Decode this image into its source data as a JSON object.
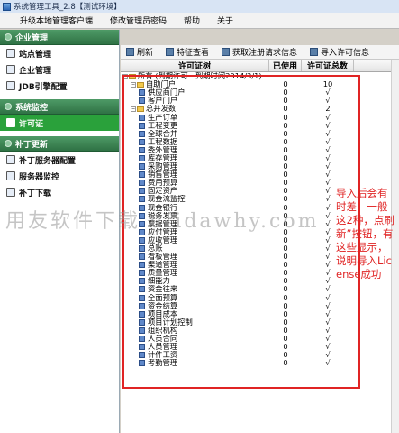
{
  "window": {
    "title": "系统管理工具_2.8【测试环境】"
  },
  "menubar": {
    "items": [
      "升级本地管理客户端",
      "修改管理员密码",
      "帮助",
      "关于"
    ]
  },
  "sidebar": {
    "sections": [
      {
        "header": "企业管理",
        "items": [
          "站点管理",
          "企业管理",
          "JDB引擎配置"
        ]
      },
      {
        "header": "系统监控",
        "items": [
          "许可证"
        ]
      },
      {
        "header": "补丁更新",
        "items": [
          "补丁服务器配置",
          "服务器监控",
          "补丁下载"
        ]
      }
    ],
    "active": "许可证"
  },
  "toolbar": {
    "buttons": [
      "刷新",
      "特征查看",
      "获取注册请求信息",
      "导入许可信息"
    ]
  },
  "grid": {
    "columns": [
      "许可证树",
      "已使用",
      "许可证总数"
    ],
    "rows": [
      {
        "level": 0,
        "type": "folder",
        "name": "所有 (到期许可一到期时间2014/3/1)",
        "used": "",
        "total": ""
      },
      {
        "level": 1,
        "type": "folder",
        "name": "自助门户",
        "used": "0",
        "total": "10"
      },
      {
        "level": 2,
        "type": "leaf",
        "name": "供应商门户",
        "used": "0",
        "total": "√"
      },
      {
        "level": 2,
        "type": "leaf",
        "name": "客户门户",
        "used": "0",
        "total": "√"
      },
      {
        "level": 1,
        "type": "folder",
        "name": "总并发数",
        "used": "0",
        "total": "2"
      },
      {
        "level": 2,
        "type": "leaf",
        "name": "生产订单",
        "used": "0",
        "total": "√"
      },
      {
        "level": 2,
        "type": "leaf",
        "name": "工程变更",
        "used": "0",
        "total": "√"
      },
      {
        "level": 2,
        "type": "leaf",
        "name": "全球合并",
        "used": "0",
        "total": "√"
      },
      {
        "level": 2,
        "type": "leaf",
        "name": "工程数据",
        "used": "0",
        "total": "√"
      },
      {
        "level": 2,
        "type": "leaf",
        "name": "委外管理",
        "used": "0",
        "total": "√"
      },
      {
        "level": 2,
        "type": "leaf",
        "name": "库存管理",
        "used": "0",
        "total": "√"
      },
      {
        "level": 2,
        "type": "leaf",
        "name": "采购管理",
        "used": "0",
        "total": "√"
      },
      {
        "level": 2,
        "type": "leaf",
        "name": "销售管理",
        "used": "0",
        "total": "√"
      },
      {
        "level": 2,
        "type": "leaf",
        "name": "费用预算",
        "used": "0",
        "total": "√"
      },
      {
        "level": 2,
        "type": "leaf",
        "name": "固定资产",
        "used": "0",
        "total": "√"
      },
      {
        "level": 2,
        "type": "leaf",
        "name": "现金流监控",
        "used": "0",
        "total": "√"
      },
      {
        "level": 2,
        "type": "leaf",
        "name": "现金银行",
        "used": "0",
        "total": "√"
      },
      {
        "level": 2,
        "type": "leaf",
        "name": "税务发票",
        "used": "0",
        "total": "√"
      },
      {
        "level": 2,
        "type": "leaf",
        "name": "票据管理",
        "used": "0",
        "total": "√"
      },
      {
        "level": 2,
        "type": "leaf",
        "name": "应付管理",
        "used": "0",
        "total": "√"
      },
      {
        "level": 2,
        "type": "leaf",
        "name": "应收管理",
        "used": "0",
        "total": "√"
      },
      {
        "level": 2,
        "type": "leaf",
        "name": "总账",
        "used": "0",
        "total": "√"
      },
      {
        "level": 2,
        "type": "leaf",
        "name": "看板管理",
        "used": "0",
        "total": "√"
      },
      {
        "level": 2,
        "type": "leaf",
        "name": "渠道管理",
        "used": "0",
        "total": "√"
      },
      {
        "level": 2,
        "type": "leaf",
        "name": "质量管理",
        "used": "0",
        "total": "√"
      },
      {
        "level": 2,
        "type": "leaf",
        "name": "细能力",
        "used": "0",
        "total": "√"
      },
      {
        "level": 2,
        "type": "leaf",
        "name": "资金往来",
        "used": "0",
        "total": "√"
      },
      {
        "level": 2,
        "type": "leaf",
        "name": "全面预算",
        "used": "0",
        "total": "√"
      },
      {
        "level": 2,
        "type": "leaf",
        "name": "资金结算",
        "used": "0",
        "total": "√"
      },
      {
        "level": 2,
        "type": "leaf",
        "name": "项目成本",
        "used": "0",
        "total": "√"
      },
      {
        "level": 2,
        "type": "leaf",
        "name": "项目计划控制",
        "used": "0",
        "total": "√"
      },
      {
        "level": 2,
        "type": "leaf",
        "name": "组织机构",
        "used": "0",
        "total": "√"
      },
      {
        "level": 2,
        "type": "leaf",
        "name": "人员合同",
        "used": "0",
        "total": "√"
      },
      {
        "level": 2,
        "type": "leaf",
        "name": "人员管理",
        "used": "0",
        "total": "√"
      },
      {
        "level": 2,
        "type": "leaf",
        "name": "计件工资",
        "used": "0",
        "total": "√"
      },
      {
        "level": 2,
        "type": "leaf",
        "name": "考勤管理",
        "used": "0",
        "total": "√"
      }
    ]
  },
  "annotation": {
    "text": "导入后会有时差，一般这2种，点刷新”按钮，有这些显示，说明导入License成功"
  },
  "watermark": {
    "text": "用友软件下载 ufidawhy.com"
  },
  "colors": {
    "sidebar_header": "#2f7245",
    "active_item": "#2aa13b",
    "annotation": "#e02424"
  }
}
